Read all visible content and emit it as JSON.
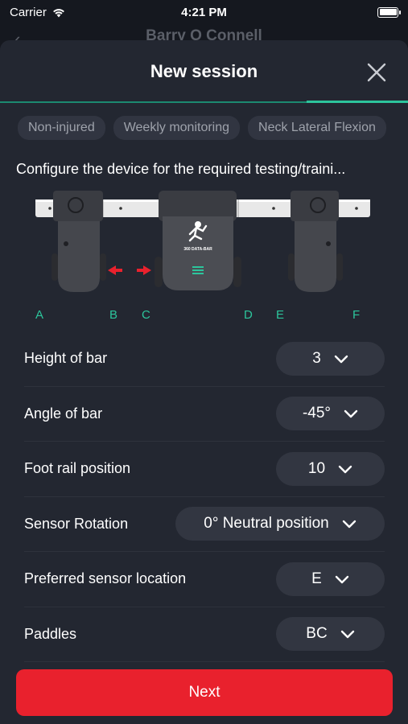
{
  "status_bar": {
    "carrier": "Carrier",
    "time": "4:21 PM"
  },
  "background_header": {
    "title": "Barry O Connell"
  },
  "sheet": {
    "title": "New session",
    "tags": [
      "Non-injured",
      "Weekly monitoring",
      "Neck Lateral Flexion"
    ],
    "instruction": "Configure the device for the required testing/traini...",
    "device": {
      "brand_text": "360 DATA-BAR",
      "position_labels": [
        "A",
        "B",
        "C",
        "D",
        "E",
        "F"
      ]
    },
    "settings": [
      {
        "label": "Height of bar",
        "value": "3"
      },
      {
        "label": "Angle of bar",
        "value": "-45°"
      },
      {
        "label": "Foot rail position",
        "value": "10"
      },
      {
        "label": "Sensor Rotation",
        "value": "0° Neutral position"
      },
      {
        "label": "Preferred sensor location",
        "value": "E"
      },
      {
        "label": "Paddles",
        "value": "BC"
      }
    ],
    "next_label": "Next"
  },
  "colors": {
    "accent": "#2cc59c",
    "primary_button": "#e9212d",
    "sheet_bg": "#232731",
    "arrow": "#e9212d"
  }
}
